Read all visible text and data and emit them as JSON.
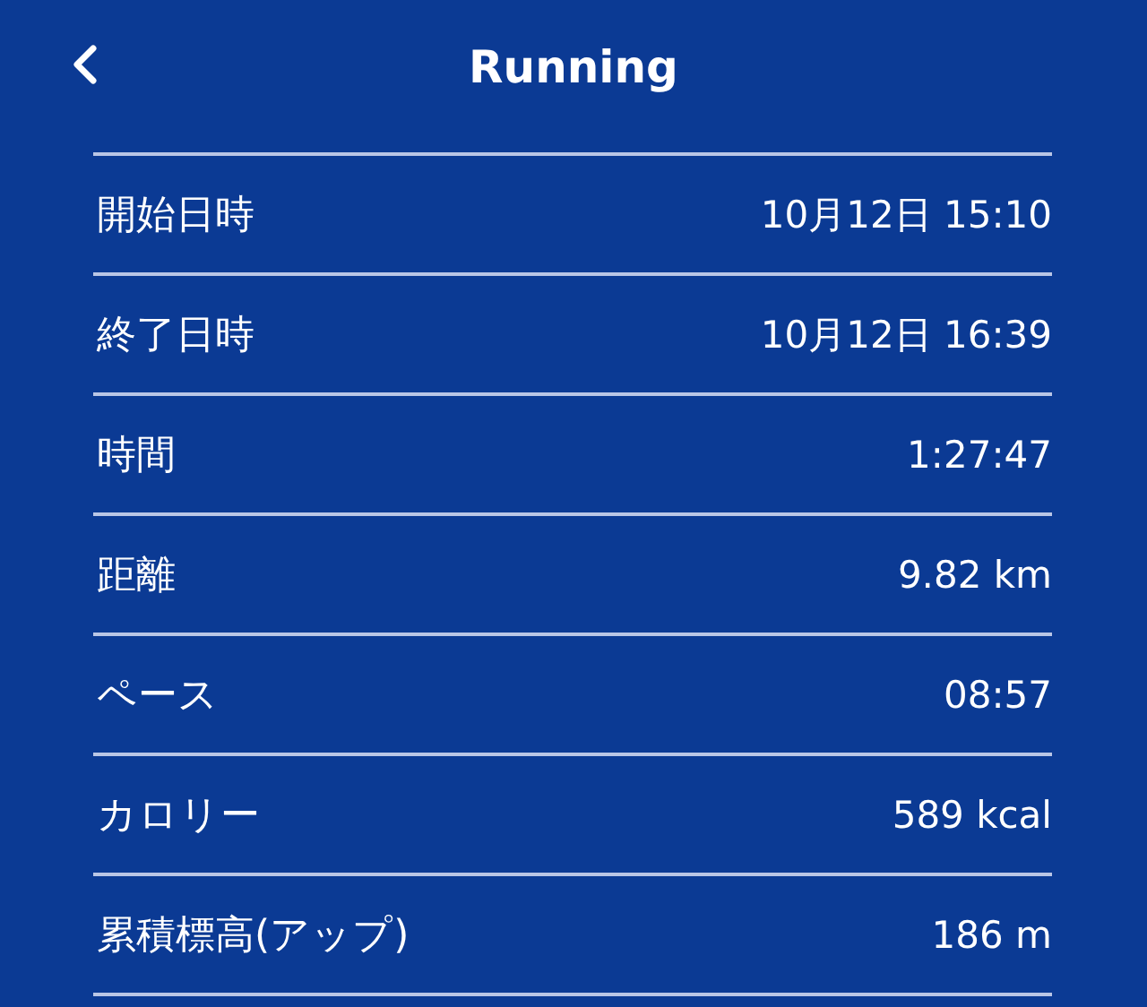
{
  "header": {
    "title": "Running"
  },
  "rows": [
    {
      "label": "開始日時",
      "value": "10月12日 15:10"
    },
    {
      "label": "終了日時",
      "value": "10月12日 16:39"
    },
    {
      "label": "時間",
      "value": "1:27:47"
    },
    {
      "label": "距離",
      "value": "9.82 km"
    },
    {
      "label": "ペース",
      "value": "08:57"
    },
    {
      "label": "カロリー",
      "value": "589 kcal"
    },
    {
      "label": "累積標高(アップ)",
      "value": "186 m"
    }
  ]
}
